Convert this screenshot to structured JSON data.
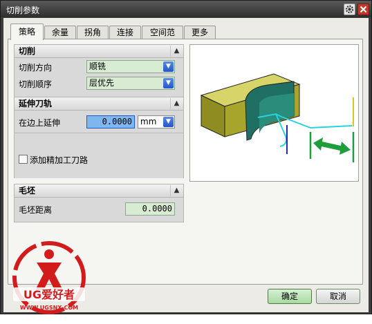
{
  "window": {
    "title": "切削参数"
  },
  "tabs": [
    {
      "label": "策略"
    },
    {
      "label": "余量"
    },
    {
      "label": "拐角"
    },
    {
      "label": "连接"
    },
    {
      "label": "空间范围"
    },
    {
      "label": "更多"
    }
  ],
  "sections": {
    "cutting": {
      "title": "切削",
      "direction_label": "切削方向",
      "direction_value": "顺铣",
      "order_label": "切削顺序",
      "order_value": "层优先"
    },
    "extend": {
      "title": "延伸刀轨",
      "edge_label": "在边上延伸",
      "edge_value": "0.0000",
      "edge_unit": "mm",
      "finish_pass_label": "添加精加工刀路",
      "finish_pass_checked": false
    },
    "blank": {
      "title": "毛坯",
      "distance_label": "毛坯距离",
      "distance_value": "0.0000"
    }
  },
  "buttons": {
    "ok": "确定",
    "cancel": "取消"
  },
  "watermark": {
    "brand": "UG爱好者",
    "url": "WWW.UGSNX.COM"
  },
  "colors": {
    "part": "#a7a52b",
    "pocket": "#1f6f62",
    "toolpath": "#28d3e0",
    "arrow": "#1e9e3a"
  }
}
